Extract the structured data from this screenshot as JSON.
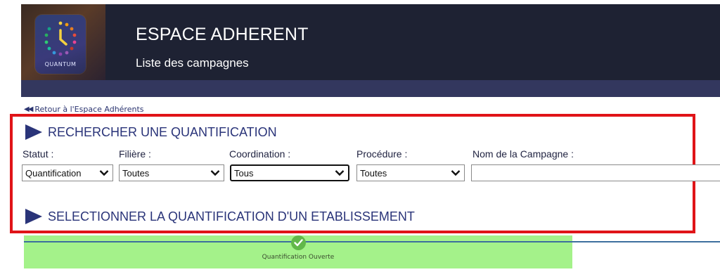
{
  "header": {
    "logo_text": "QUANTUM",
    "title": "ESPACE ADHERENT",
    "subtitle": "Liste des campagnes"
  },
  "back_link": {
    "label": "Retour à l'Espace Adhérents"
  },
  "search_section": {
    "title": "RECHERCHER UNE QUANTIFICATION"
  },
  "filters": {
    "statut": {
      "label": "Statut :",
      "value": "Quantification"
    },
    "filiere": {
      "label": "Filière :",
      "value": "Toutes"
    },
    "coordination": {
      "label": "Coordination :",
      "value": "Tous"
    },
    "procedure": {
      "label": "Procédure :",
      "value": "Toutes"
    },
    "nom_campagne": {
      "label": "Nom de la Campagne :",
      "value": ""
    }
  },
  "select_section": {
    "title": "SELECTIONNER LA  QUANTIFICATION D'UN ETABLISSEMENT"
  },
  "progress": {
    "step_label": "Quantification Ouverte"
  },
  "colors": {
    "header_bg": "#1e2233",
    "header_stripe": "#33375e",
    "accent_navy": "#2a3479",
    "highlight_red": "#e01418",
    "progress_green": "#a4f28a",
    "check_green": "#62b84a"
  },
  "icons": [
    "clock-logo-icon",
    "back-arrow-icon",
    "play-triangle-icon",
    "chevron-down-icon",
    "check-icon"
  ]
}
